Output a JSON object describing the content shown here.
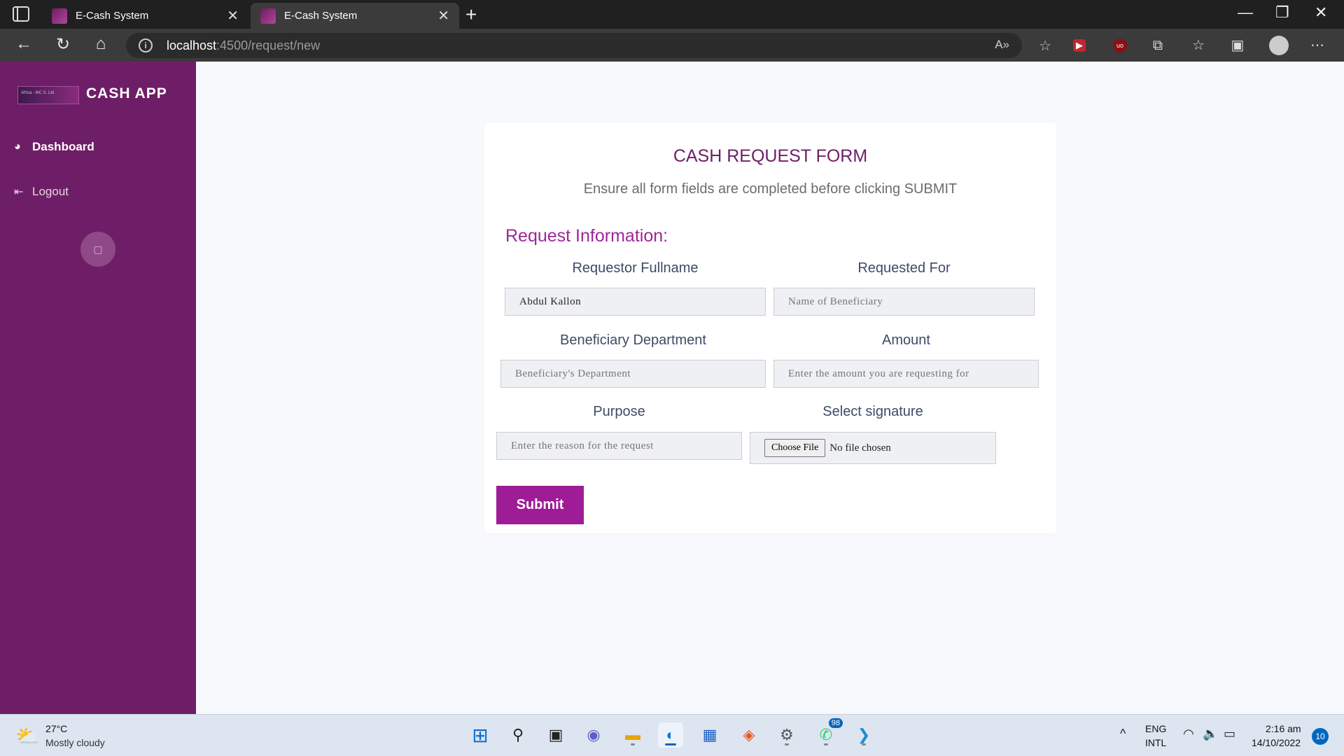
{
  "browser": {
    "tabs": [
      {
        "title": "E-Cash System"
      },
      {
        "title": "E-Cash System"
      }
    ],
    "url_host": "localhost",
    "url_path": ":4500/request/new",
    "close_glyph": "✕",
    "new_tab_glyph": "+"
  },
  "sidebar": {
    "logo_text": "Africa - MC S. Ltd",
    "brand": "CASH APP",
    "items": [
      {
        "label": "Dashboard",
        "icon": "gauge-icon"
      },
      {
        "label": "Logout",
        "icon": "logout-icon"
      }
    ],
    "colors": {
      "background": "#6e1e66",
      "accent": "#9e1d96"
    }
  },
  "form": {
    "title": "CASH REQUEST FORM",
    "subtitle": "Ensure all form fields are completed before clicking SUBMIT",
    "section_title": "Request Information:",
    "fields": {
      "requestor_fullname": {
        "label": "Requestor Fullname",
        "value": "Abdul Kallon",
        "placeholder": ""
      },
      "requested_for": {
        "label": "Requested For",
        "value": "",
        "placeholder": "Name of Beneficiary"
      },
      "beneficiary_department": {
        "label": "Beneficiary Department",
        "value": "",
        "placeholder": "Beneficiary's Department"
      },
      "amount": {
        "label": "Amount",
        "value": "",
        "placeholder": "Enter the amount you are requesting for"
      },
      "purpose": {
        "label": "Purpose",
        "value": "",
        "placeholder": "Enter the reason for the request"
      },
      "signature": {
        "label": "Select signature",
        "button": "Choose File",
        "status": "No file chosen"
      }
    },
    "submit_label": "Submit"
  },
  "taskbar": {
    "weather_temp": "27°C",
    "weather_desc": "Mostly cloudy",
    "whatsapp_badge": "98",
    "lang_line1": "ENG",
    "lang_line2": "INTL",
    "time": "2:16 am",
    "date": "14/10/2022",
    "notifications": "10"
  }
}
